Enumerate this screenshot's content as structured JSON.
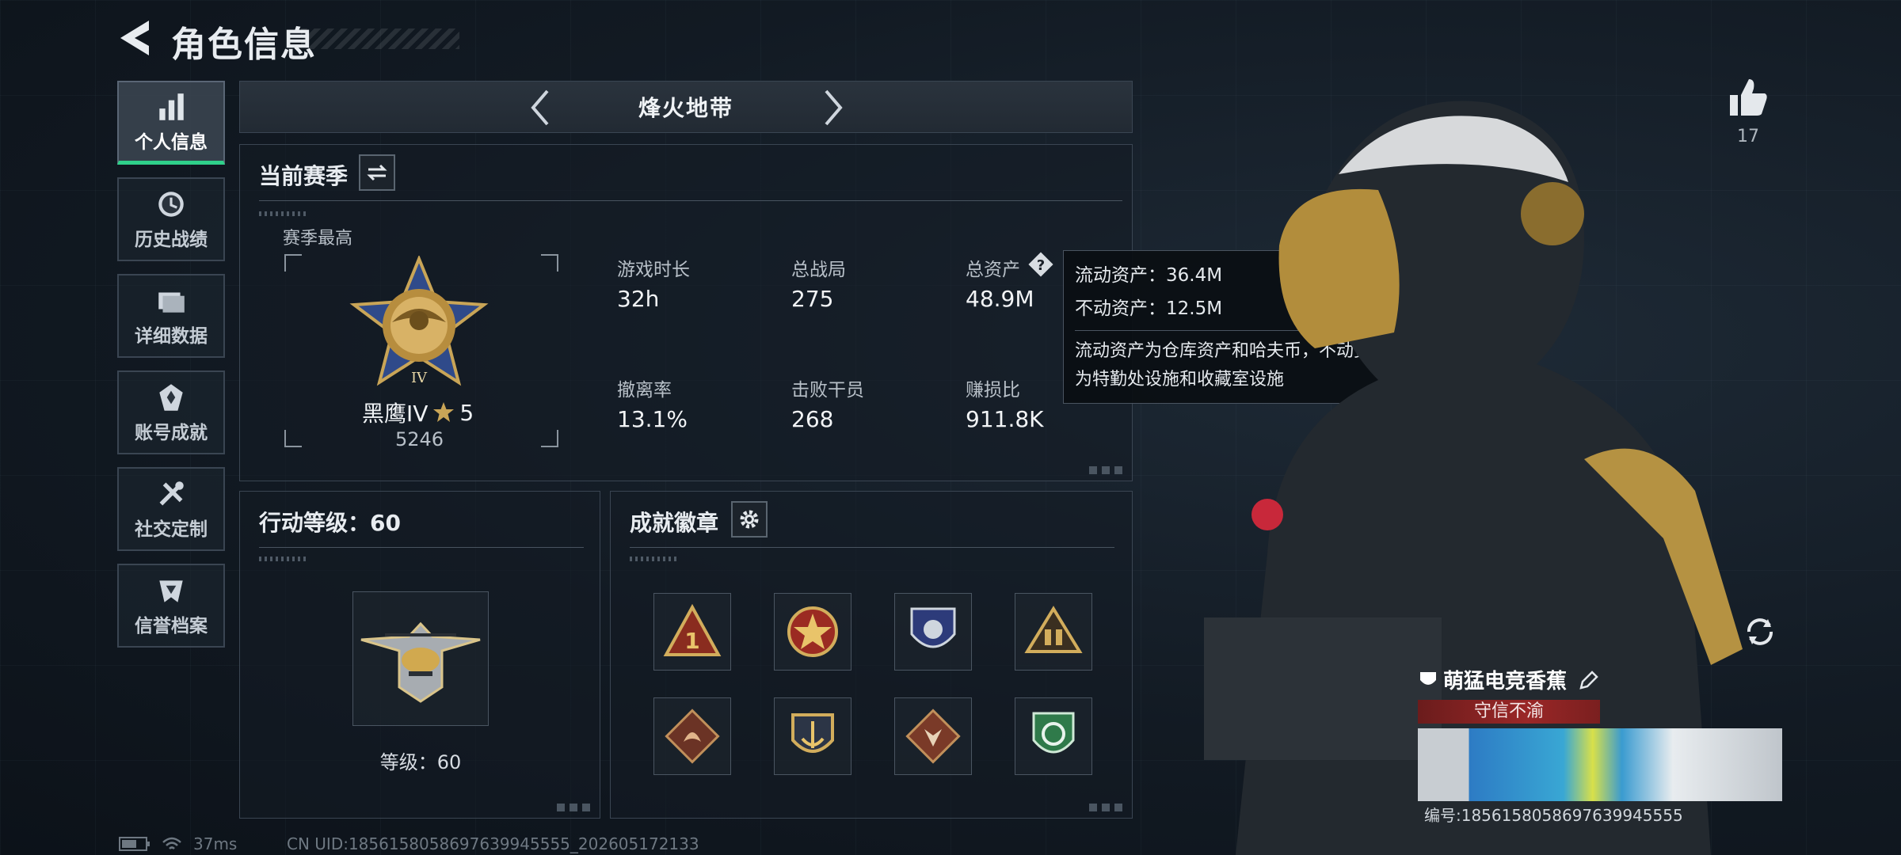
{
  "header": {
    "title": "角色信息"
  },
  "sidebar": {
    "items": [
      {
        "label": "个人信息",
        "icon": "bar-chart-icon",
        "active": true
      },
      {
        "label": "历史战绩",
        "icon": "history-icon",
        "active": false
      },
      {
        "label": "详细数据",
        "icon": "folder-icon",
        "active": false
      },
      {
        "label": "账号成就",
        "icon": "achievement-icon",
        "active": false
      },
      {
        "label": "社交定制",
        "icon": "tools-icon",
        "active": false
      },
      {
        "label": "信誉档案",
        "icon": "credit-icon",
        "active": false
      }
    ]
  },
  "mode": {
    "name": "烽火地带"
  },
  "season": {
    "title": "当前赛季",
    "best_label": "赛季最高",
    "rank_name": "黑鹰IV",
    "rank_stars": "5",
    "rank_score": "5246",
    "stats": [
      {
        "label": "游戏时长",
        "value": "32h"
      },
      {
        "label": "总战局",
        "value": "275"
      },
      {
        "label": "总资产",
        "value": "48.9M"
      },
      {
        "label": "撤离率",
        "value": "13.1%"
      },
      {
        "label": "击败干员",
        "value": "268"
      },
      {
        "label": "赚损比",
        "value": "911.8K"
      }
    ]
  },
  "tooltip": {
    "liquid": "流动资产：36.4M",
    "fixed": "不动资产：12.5M",
    "desc_line1": "流动资产为仓库资产和哈夫币，不动资产",
    "desc_line2": "为特勤处设施和收藏室设施"
  },
  "level": {
    "title": "行动等级：60",
    "badge_label": "等级：60"
  },
  "achievements": {
    "title": "成就徽章",
    "badges": [
      "triangle-badge-icon",
      "star-medal-icon",
      "shield-badge-icon",
      "soldiers-badge-icon",
      "dragon-badge-icon",
      "anchor-badge-icon",
      "wolf-badge-icon",
      "green-shield-badge-icon"
    ]
  },
  "likes": {
    "count": "17"
  },
  "card": {
    "name": "萌猛电竞香蕉",
    "tag": "守信不渝",
    "id": "编号:1856158058697639945555"
  },
  "status": {
    "ping": "37ms",
    "uid": "CN UID:1856158058697639945555_202605172133"
  },
  "colors": {
    "accent": "#2fd08a",
    "tag_red": "#9a2727"
  }
}
